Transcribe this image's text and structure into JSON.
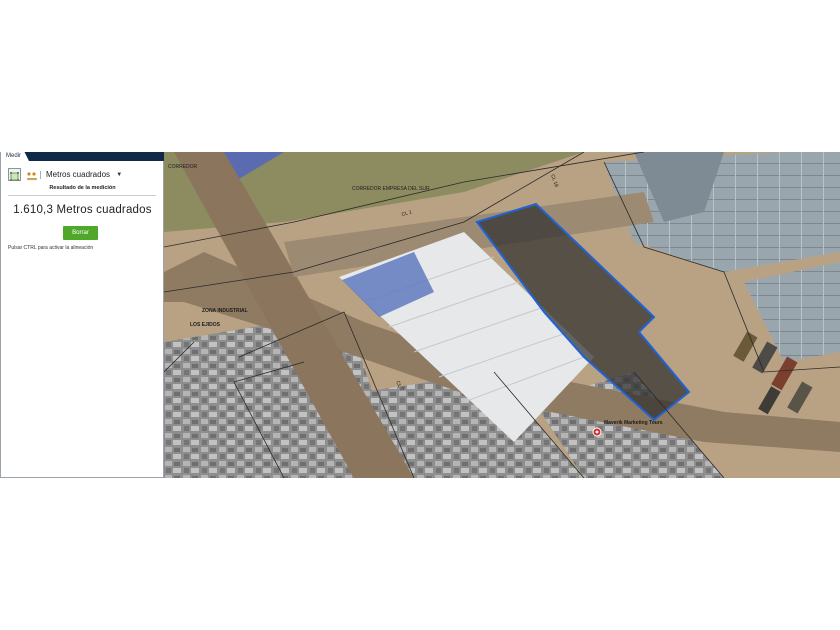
{
  "panel": {
    "tab_label": "Medir",
    "tools": [
      {
        "name": "area-measure-tool",
        "icon": "area-measure-icon",
        "active": true
      },
      {
        "name": "distance-measure-tool",
        "icon": "distance-measure-icon",
        "active": false
      }
    ],
    "unit_selected": "Metros cuadrados",
    "result_heading": "Resultado de la medición",
    "result_value": "1.610,3 Metros cuadrados",
    "clear_label": "Borrar",
    "hint": "Pulsar CTRL para activar la alineación",
    "accent": "#4fa82a",
    "header_color": "#0f2a47"
  },
  "map": {
    "labels": {
      "street_1": "CORREDOR",
      "street_2": "CORREDOR EMPRESA DEL SUR",
      "zone_1": "ZONA INDUSTRIAL",
      "zone_2": "LOS EJIDOS",
      "road_1": "CL 1",
      "road_2": "CL 18",
      "road_3": "CL 7",
      "poi": "Maverik Marketing Tours"
    },
    "measure_outline_color": "#1f63d6",
    "poi_icon": "map-pin-icon"
  }
}
